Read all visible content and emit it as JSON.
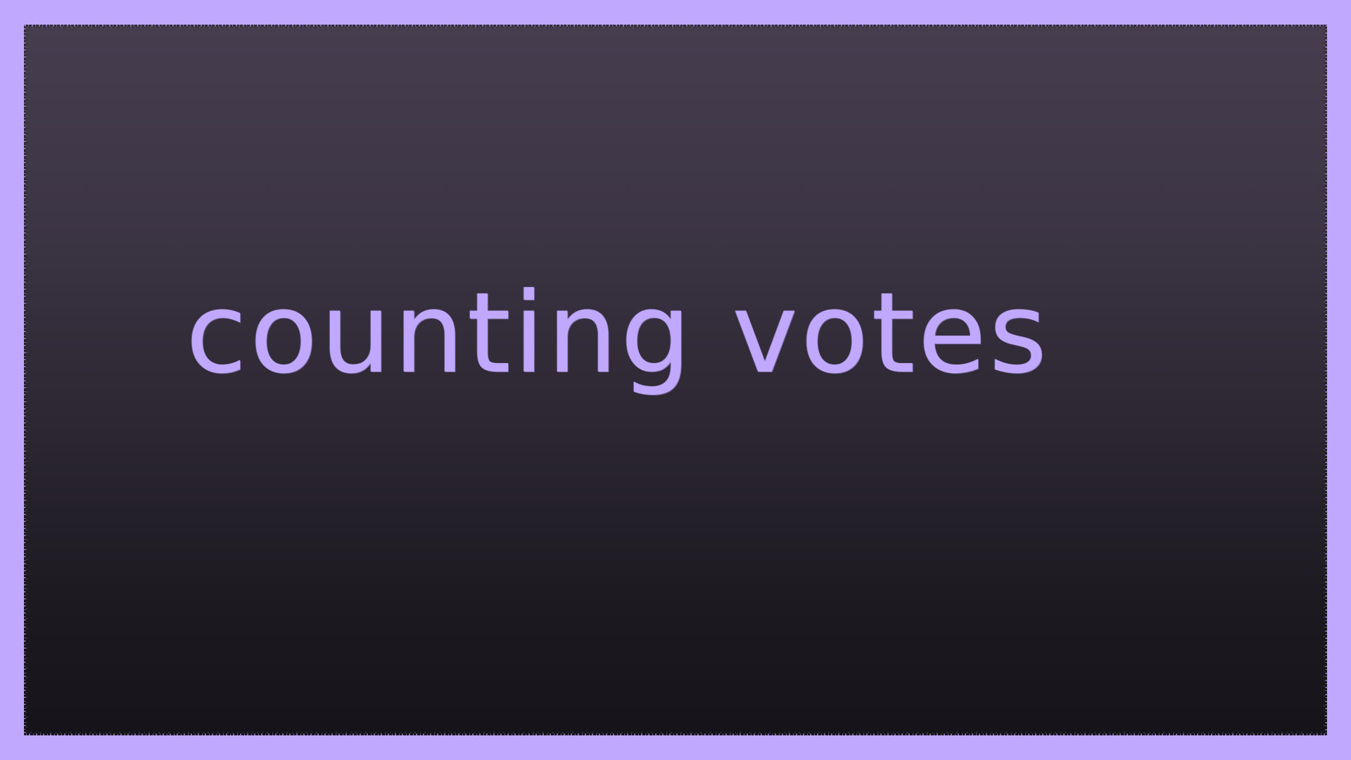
{
  "slide": {
    "title": "counting votes",
    "accent_color": "#c0a8ff",
    "board_color_top": "#463e4f",
    "board_color_bottom": "#16141a"
  }
}
